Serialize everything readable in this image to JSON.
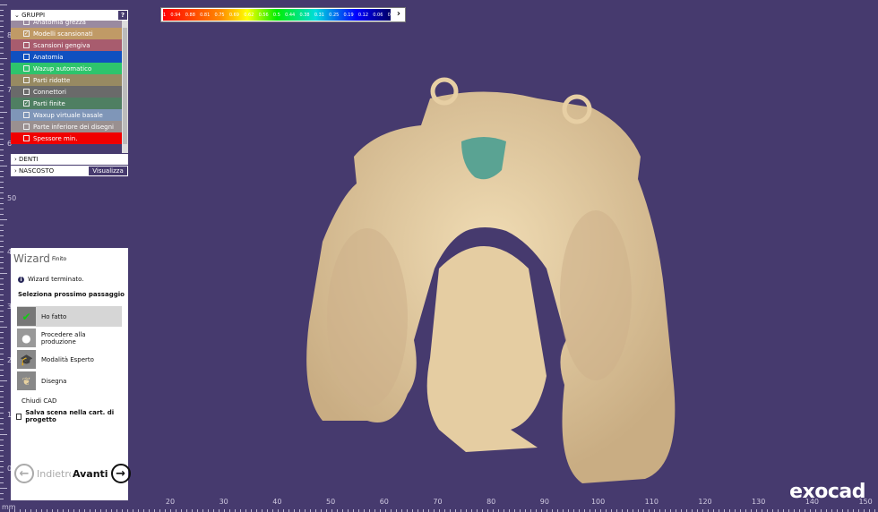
{
  "legend": {
    "labels": [
      "1",
      "0.94",
      "0.88",
      "0.81",
      "0.75",
      "0.69",
      "0.62",
      "0.56",
      "0.5",
      "0.44",
      "0.38",
      "0.31",
      "0.25",
      "0.19",
      "0.12",
      "0.06",
      "0"
    ],
    "expand_icon": "chevron-right-icon"
  },
  "groups": {
    "title": "GRUPPI",
    "help": "?",
    "items": [
      {
        "label": "Anatomia grezza",
        "color": "#9a8aa0",
        "checked": false
      },
      {
        "label": "Modelli scansionati",
        "color": "#c09a66",
        "checked": true
      },
      {
        "label": "Scansioni gengiva",
        "color": "#a85c6e",
        "checked": false
      },
      {
        "label": "Anatomia",
        "color": "#1050c0",
        "checked": false
      },
      {
        "label": "Wazup automatico",
        "color": "#2ec46c",
        "checked": false
      },
      {
        "label": "Parti ridotte",
        "color": "#978a62",
        "checked": false
      },
      {
        "label": "Connettori",
        "color": "#6a6a6a",
        "checked": false
      },
      {
        "label": "Parti finite",
        "color": "#4f7f62",
        "checked": true
      },
      {
        "label": "Waxup virtuale basale",
        "color": "#7f96b8",
        "checked": false
      },
      {
        "label": "Parte inferiore dei disegni",
        "color": "#9a9090",
        "checked": false
      },
      {
        "label": "Spessore min.",
        "color": "#f00000",
        "checked": false
      }
    ]
  },
  "denti": "DENTI",
  "nascosto": "NASCOSTO",
  "visualizza": "Visualizza",
  "wizard": {
    "title": "Wizard",
    "status": "Finito",
    "info": "Wizard terminato.",
    "prompt": "Seleziona prossimo passaggio",
    "options": [
      "Ho fatto",
      "Procedere alla produzione",
      "Modalità Esperto",
      "Disegna"
    ],
    "close": "Chiudi CAD",
    "save": "Salva scena nella cart. di progetto",
    "back": "Indietro",
    "next": "Avanti"
  },
  "ruler": {
    "unit": "mm",
    "left": [
      "8",
      "7",
      "6",
      "50",
      "4",
      "3",
      "2",
      "1",
      "0"
    ],
    "bottom": [
      "20",
      "30",
      "40",
      "50",
      "60",
      "70",
      "80",
      "90",
      "100",
      "110",
      "120",
      "130",
      "140",
      "150"
    ]
  },
  "logo": "exocad"
}
